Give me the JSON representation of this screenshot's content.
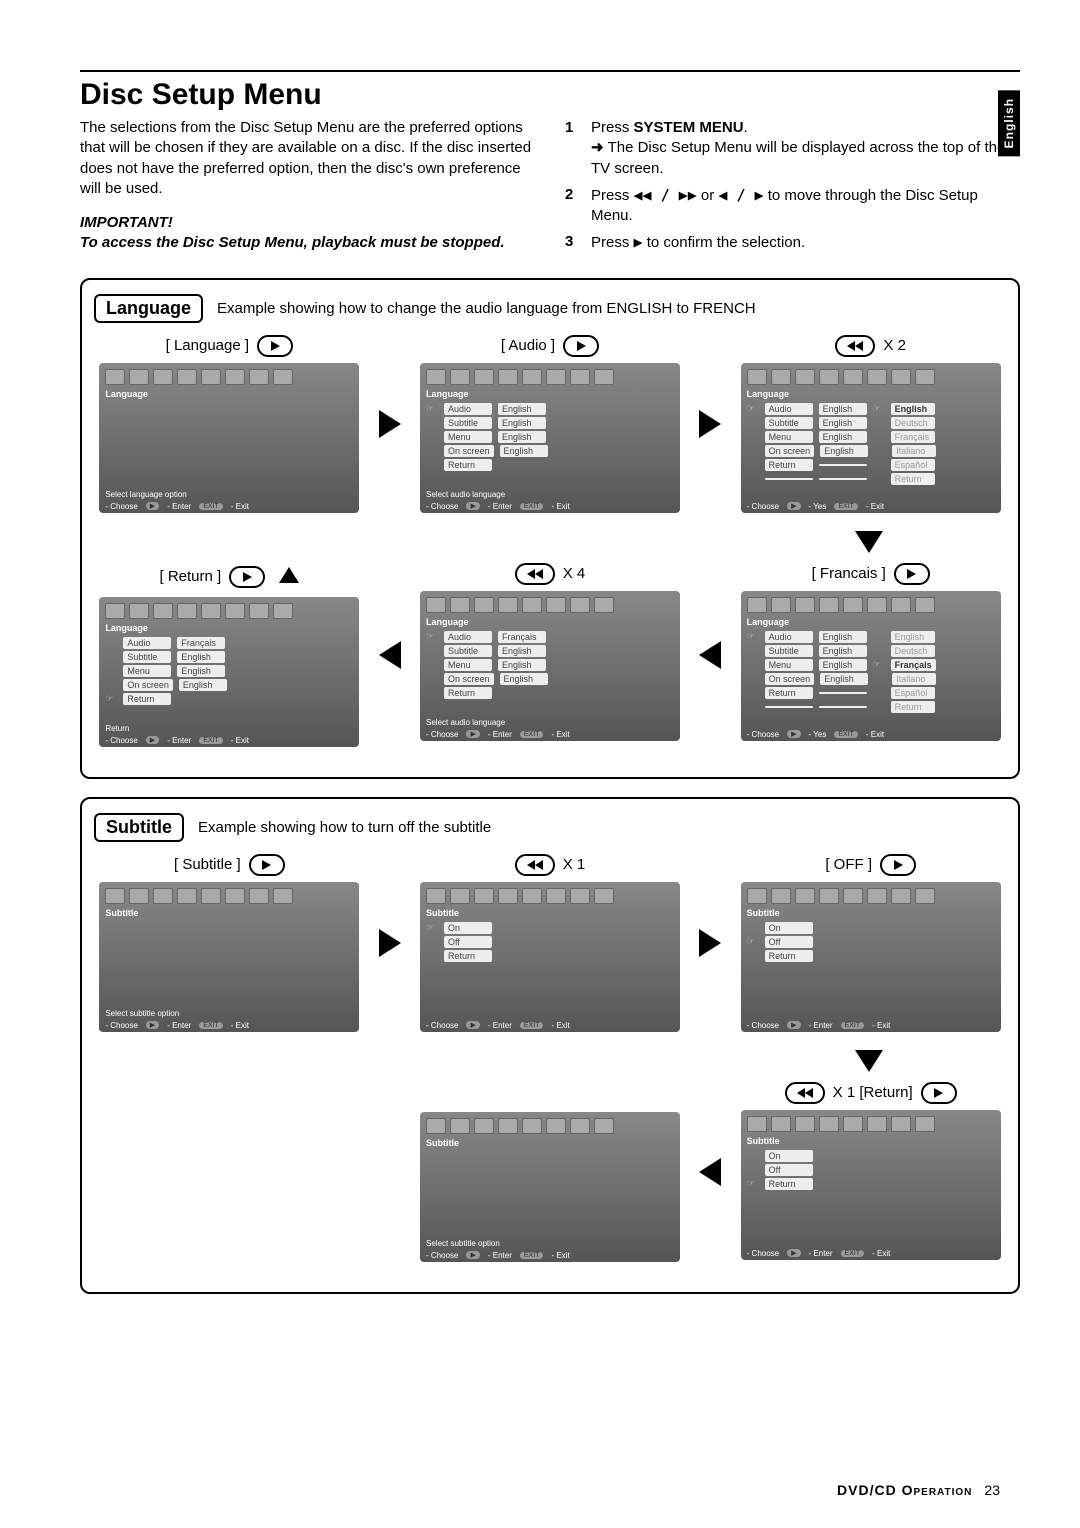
{
  "side_tab": "English",
  "title": "Disc Setup Menu",
  "intro": "The selections from the Disc Setup Menu are the preferred options that will be chosen if they are available on a disc.  If the disc inserted does not have the preferred option, then the disc's own preference will be used.",
  "important": {
    "title": "IMPORTANT!",
    "text": "To access the Disc Setup Menu, playback must be stopped."
  },
  "steps": {
    "s1_a": "Press ",
    "s1_b": "SYSTEM MENU",
    "s1_c": ".",
    "s1_sub": "The Disc Setup Menu will be displayed across the top of the TV screen.",
    "s2_a": "Press ",
    "s2_nav1": "◀◀ / ▶▶",
    "s2_mid": " or ",
    "s2_nav2": "◀ / ▶",
    "s2_b": " to move through the Disc Setup Menu.",
    "s3_a": "Press ",
    "s3_nav": "▶",
    "s3_b": " to confirm the selection."
  },
  "lang": {
    "label": "Language",
    "desc": "Example showing how to change the audio language from ENGLISH to FRENCH",
    "steps": {
      "s1": "[ Language ]",
      "s2": "[ Audio ]",
      "s3": "X 2",
      "s4": "[ Return ]",
      "s5": "X 4",
      "s6": "[ Francais ]"
    },
    "screens": {
      "status_lang": "Select language option",
      "status_audio": "Select audio language",
      "status_return": "Return",
      "section": "Language",
      "rows": [
        "Audio",
        "Subtitle",
        "Menu",
        "On screen",
        "Return"
      ],
      "english": "English",
      "francais": "Français",
      "options": [
        "English",
        "Deutsch",
        "Français",
        "Italiano",
        "Español",
        "Return"
      ],
      "foot_choose": "- Choose",
      "foot_enter": "- Enter",
      "foot_yes": "- Yes",
      "foot_exit": "- Exit",
      "foot_exit_pill": "EXIT"
    }
  },
  "sub": {
    "label": "Subtitle",
    "desc": "Example showing how to turn off the subtitle",
    "steps": {
      "s1": "[ Subtitle ]",
      "s2": "X 1",
      "s3": "[ OFF ]",
      "s4": "X 1 [Return]"
    },
    "screens": {
      "status_sub": "Select subtitle option",
      "section": "Subtitle",
      "rows": [
        "On",
        "Off",
        "Return"
      ],
      "foot_choose": "- Choose",
      "foot_enter": "- Enter",
      "foot_exit": "- Exit",
      "foot_exit_pill": "EXIT"
    }
  },
  "footer": {
    "label": "DVD/CD Operation",
    "page": "23"
  }
}
